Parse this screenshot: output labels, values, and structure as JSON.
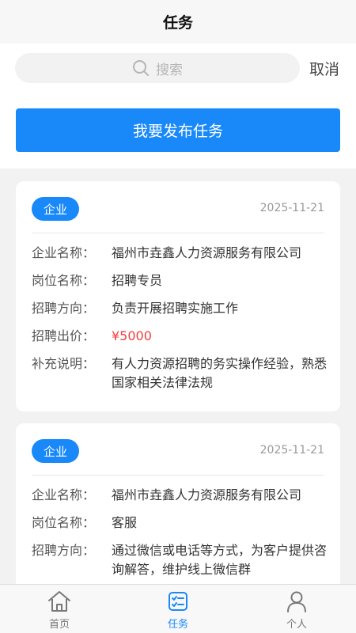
{
  "header": {
    "title": "任务"
  },
  "search": {
    "placeholder": "搜索",
    "cancel_label": "取消"
  },
  "publish_button": "我要发布任务",
  "tasks": [
    {
      "tag": "企业",
      "date": "2025-11-21",
      "rows": [
        {
          "label": "企业名称：",
          "value": "福州市垚鑫人力资源服务有限公司"
        },
        {
          "label": "岗位名称：",
          "value": "招聘专员"
        },
        {
          "label": "招聘方向：",
          "value": "负责开展招聘实施工作"
        },
        {
          "label": "招聘出价：",
          "value": "¥5000"
        },
        {
          "label": "补充说明：",
          "value": "有人力资源招聘的务实操作经验，熟悉国家相关法律法规"
        }
      ]
    },
    {
      "tag": "企业",
      "date": "2025-11-21",
      "rows": [
        {
          "label": "企业名称：",
          "value": "福州市垚鑫人力资源服务有限公司"
        },
        {
          "label": "岗位名称：",
          "value": "客服"
        },
        {
          "label": "招聘方向：",
          "value": "通过微信或电话等方式，为客户提供咨询解答，维护线上微信群"
        }
      ]
    }
  ],
  "tabbar": {
    "items": [
      {
        "label": "首页",
        "icon": "home-icon"
      },
      {
        "label": "任务",
        "icon": "task-list-icon"
      },
      {
        "label": "个人",
        "icon": "person-icon"
      }
    ],
    "active_color": "#1989fa",
    "inactive_color": "#777777"
  },
  "colors": {
    "accent": "#1989fa",
    "price": "#f23d3d"
  }
}
